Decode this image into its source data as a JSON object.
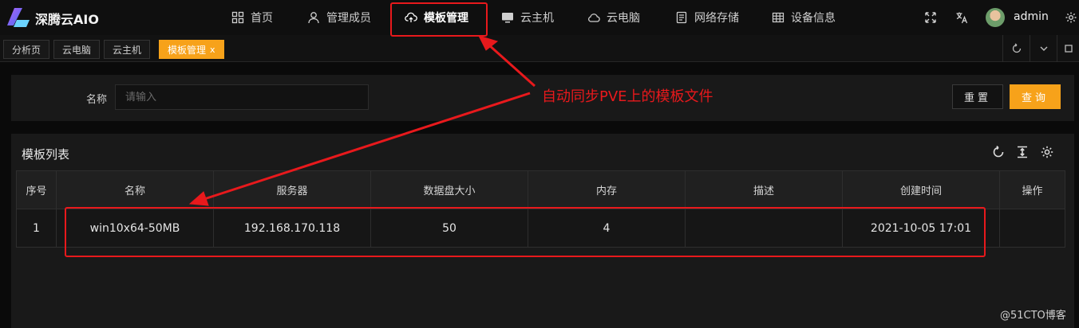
{
  "app": {
    "brand": "深腾云AIO",
    "nav": [
      {
        "label": "首页",
        "icon": "grid-icon"
      },
      {
        "label": "管理成员",
        "icon": "user-icon"
      },
      {
        "label": "模板管理",
        "icon": "cloud-upload-icon",
        "active": true
      },
      {
        "label": "云主机",
        "icon": "monitor-icon"
      },
      {
        "label": "云电脑",
        "icon": "cloud-icon"
      },
      {
        "label": "网络存储",
        "icon": "storage-icon"
      },
      {
        "label": "设备信息",
        "icon": "table-icon"
      }
    ],
    "user": "admin",
    "tool_icons": [
      "fullscreen-icon",
      "translate-icon",
      "gear-icon"
    ]
  },
  "tabs": [
    {
      "label": "分析页"
    },
    {
      "label": "云电脑"
    },
    {
      "label": "云主机"
    },
    {
      "label": "模板管理",
      "active": true,
      "close": "x"
    }
  ],
  "search": {
    "label": "名称",
    "placeholder": "请输入",
    "value": "",
    "reset_label": "重置",
    "query_label": "查询"
  },
  "table": {
    "title": "模板列表",
    "columns": [
      "序号",
      "名称",
      "服务器",
      "数据盘大小",
      "内存",
      "描述",
      "创建时间",
      "操作"
    ],
    "rows": [
      [
        "1",
        "win10x64-50MB",
        "192.168.170.118",
        "50",
        "4",
        "",
        "2021-10-05 17:01",
        ""
      ]
    ]
  },
  "annotation": {
    "text": "自动同步PVE上的模板文件",
    "color": "#e8191c"
  },
  "watermark": "@51CTO博客",
  "colors": {
    "accent": "#f7a21a",
    "background": "#0a0a0a",
    "panel": "#191919",
    "annotation": "#e8191c"
  }
}
